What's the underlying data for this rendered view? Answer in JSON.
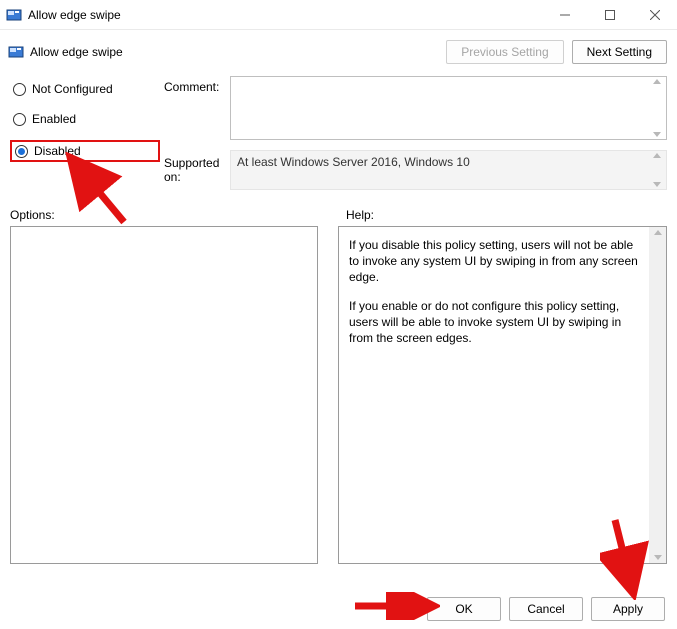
{
  "titlebar": {
    "title": "Allow edge swipe"
  },
  "header": {
    "setting_name": "Allow edge swipe",
    "prev_btn": "Previous Setting",
    "next_btn": "Next Setting"
  },
  "state": {
    "not_configured": "Not Configured",
    "enabled": "Enabled",
    "disabled": "Disabled",
    "selected": "disabled"
  },
  "labels": {
    "comment": "Comment:",
    "supported_on": "Supported on:",
    "options": "Options:",
    "help": "Help:"
  },
  "fields": {
    "comment": "",
    "supported_on": "At least Windows Server 2016, Windows 10"
  },
  "help": {
    "p1": "If you disable this policy setting, users will not be able to invoke any system UI by swiping in from any screen edge.",
    "p2": "If you enable or do not configure this policy setting, users will be able to invoke system UI by swiping in from the screen edges."
  },
  "footer": {
    "ok": "OK",
    "cancel": "Cancel",
    "apply": "Apply"
  }
}
